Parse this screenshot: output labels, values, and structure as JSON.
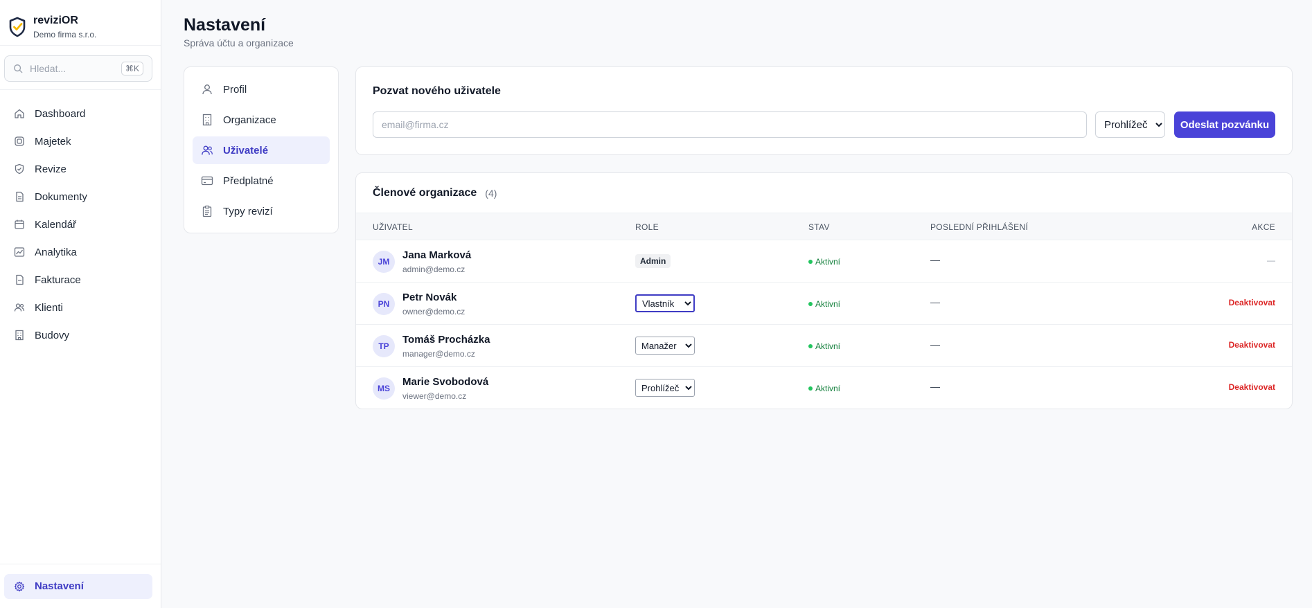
{
  "brand": {
    "name": "reviziOR",
    "company": "Demo firma s.r.o."
  },
  "search": {
    "placeholder": "Hledat...",
    "shortcut": "⌘K"
  },
  "sidebar": {
    "items": [
      {
        "label": "Dashboard",
        "icon": "home-icon"
      },
      {
        "label": "Majetek",
        "icon": "cube-icon"
      },
      {
        "label": "Revize",
        "icon": "shield-check-icon"
      },
      {
        "label": "Dokumenty",
        "icon": "document-icon"
      },
      {
        "label": "Kalendář",
        "icon": "calendar-icon"
      },
      {
        "label": "Analytika",
        "icon": "chart-icon"
      },
      {
        "label": "Fakturace",
        "icon": "invoice-icon"
      },
      {
        "label": "Klienti",
        "icon": "users-icon"
      },
      {
        "label": "Budovy",
        "icon": "building-icon"
      }
    ],
    "settings": {
      "label": "Nastavení",
      "icon": "gear-icon"
    }
  },
  "header": {
    "title": "Nastavení",
    "subtitle": "Správa účtu a organizace"
  },
  "settings_menu": [
    {
      "label": "Profil",
      "icon": "user-icon"
    },
    {
      "label": "Organizace",
      "icon": "building-icon"
    },
    {
      "label": "Uživatelé",
      "icon": "users-icon",
      "active": true
    },
    {
      "label": "Předplatné",
      "icon": "credit-card-icon"
    },
    {
      "label": "Typy revizí",
      "icon": "clipboard-icon"
    }
  ],
  "invite": {
    "title": "Pozvat nového uživatele",
    "email_placeholder": "email@firma.cz",
    "role_value": "Prohlížeč",
    "submit_label": "Odeslat pozvánku"
  },
  "members": {
    "title": "Členové organizace",
    "count": "(4)",
    "columns": [
      "Uživatel",
      "Role",
      "Stav",
      "Poslední přihlášení",
      "Akce"
    ],
    "rows": [
      {
        "initials": "JM",
        "name": "Jana Marková",
        "email": "admin@demo.cz",
        "role": "Admin",
        "role_editable": false,
        "status": "Aktivní",
        "last_login": "—",
        "action": "—"
      },
      {
        "initials": "PN",
        "name": "Petr Novák",
        "email": "owner@demo.cz",
        "role": "Vlastník",
        "role_editable": true,
        "status": "Aktivní",
        "last_login": "—",
        "action": "Deaktivovat"
      },
      {
        "initials": "TP",
        "name": "Tomáš Procházka",
        "email": "manager@demo.cz",
        "role": "Manažer",
        "role_editable": true,
        "status": "Aktivní",
        "last_login": "—",
        "action": "Deaktivovat"
      },
      {
        "initials": "MS",
        "name": "Marie Svobodová",
        "email": "viewer@demo.cz",
        "role": "Prohlížeč",
        "role_editable": true,
        "status": "Aktivní",
        "last_login": "—",
        "action": "Deaktivovat"
      }
    ]
  },
  "colors": {
    "accent": "#4a43d8",
    "active_bg": "#eef0fd",
    "danger": "#dc2626",
    "success": "#22c55e"
  }
}
